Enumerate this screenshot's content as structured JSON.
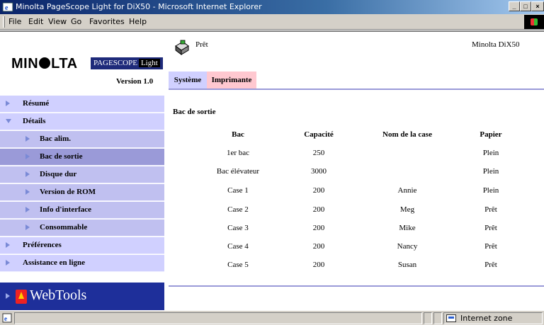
{
  "window": {
    "title": "Minolta PageScope Light for DiX50 - Microsoft Internet Explorer",
    "controls": [
      "minimize",
      "maximize",
      "close"
    ]
  },
  "menubar": {
    "items": [
      "File",
      "Edit",
      "View",
      "Go",
      "Favorites",
      "Help"
    ]
  },
  "brand": {
    "logo_text": "MINOLTA",
    "product_logo": "PageScope Light",
    "version": "Version 1.0"
  },
  "nav": {
    "items": [
      {
        "label": "Résumé",
        "level": 0,
        "expanded": false,
        "selected": false
      },
      {
        "label": "Détails",
        "level": 0,
        "expanded": true,
        "selected": false
      },
      {
        "label": "Bac alim.",
        "level": 1,
        "selected": false
      },
      {
        "label": "Bac de sortie",
        "level": 1,
        "selected": true
      },
      {
        "label": "Disque dur",
        "level": 1,
        "selected": false
      },
      {
        "label": "Version de ROM",
        "level": 1,
        "selected": false
      },
      {
        "label": "Info d'interface",
        "level": 1,
        "selected": false
      },
      {
        "label": "Consommable",
        "level": 1,
        "selected": false
      },
      {
        "label": "Préférences",
        "level": 0,
        "expanded": false,
        "selected": false
      },
      {
        "label": "Assistance en ligne",
        "level": 0,
        "expanded": false,
        "selected": false
      }
    ],
    "webtools_label": "WebTools"
  },
  "header": {
    "status": "Prêt",
    "model": "Minolta DiX50",
    "printer_icon": "printer-icon"
  },
  "tabs": [
    {
      "label": "Système",
      "active": true
    },
    {
      "label": "Imprimante",
      "active": false
    }
  ],
  "content": {
    "section_title": "Bac de sortie",
    "table": {
      "headers": [
        "Bac",
        "Capacité",
        "Nom de la case",
        "Papier"
      ],
      "rows": [
        [
          "1er bac",
          "250",
          "",
          "Plein"
        ],
        [
          "Bac élévateur",
          "3000",
          "",
          "Plein"
        ],
        [
          "Case 1",
          "200",
          "Annie",
          "Plein"
        ],
        [
          "Case 2",
          "200",
          "Meg",
          "Prêt"
        ],
        [
          "Case 3",
          "200",
          "Mike",
          "Prêt"
        ],
        [
          "Case 4",
          "200",
          "Nancy",
          "Prêt"
        ],
        [
          "Case 5",
          "200",
          "Susan",
          "Prêt"
        ]
      ]
    }
  },
  "statusbar": {
    "zone": "Internet zone"
  },
  "colors": {
    "nav_background": "#d0d0ff",
    "nav_selected": "#9a9ad8",
    "tab_systeme": "#d0d0ff",
    "tab_imprimante": "#ffc8d0",
    "webtools_background": "#1e2f9a"
  }
}
